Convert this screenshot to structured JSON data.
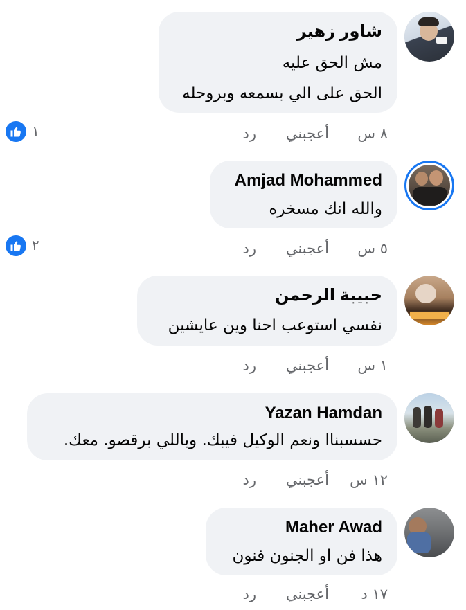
{
  "comments": [
    {
      "author": "شاور زهير",
      "lines": [
        "مش الحق عليه",
        "الحق على الي بسمعه وبروحله"
      ],
      "time": "٨ س",
      "like_label": "أعجبني",
      "reply_label": "رد",
      "reactions": "١",
      "story_ring": false
    },
    {
      "author": "Amjad Mohammed",
      "lines": [
        "والله انك مسخره"
      ],
      "time": "٥ س",
      "like_label": "أعجبني",
      "reply_label": "رد",
      "reactions": "٢",
      "story_ring": true
    },
    {
      "author": "حبيبة الرحمن",
      "lines": [
        "نفسي استوعب احنا وين عايشين"
      ],
      "time": "١ س",
      "like_label": "أعجبني",
      "reply_label": "رد",
      "reactions": null,
      "story_ring": false
    },
    {
      "author": "Yazan Hamdan",
      "lines": [
        "حسسبناا ونعم الوكيل فيبك. وباللي برقصو. معك."
      ],
      "time": "١٢ س",
      "like_label": "أعجبني",
      "reply_label": "رد",
      "reactions": null,
      "story_ring": false
    },
    {
      "author": "Maher Awad",
      "lines": [
        "هذا فن او الجنون فنون"
      ],
      "time": "١٧ د",
      "like_label": "أعجبني",
      "reply_label": "رد",
      "reactions": null,
      "story_ring": false
    }
  ],
  "colors": {
    "bubble": "#f0f2f5",
    "meta_text": "#65676b",
    "like_blue": "#1877f2"
  },
  "icons": {
    "reaction": "like-thumb-icon"
  }
}
